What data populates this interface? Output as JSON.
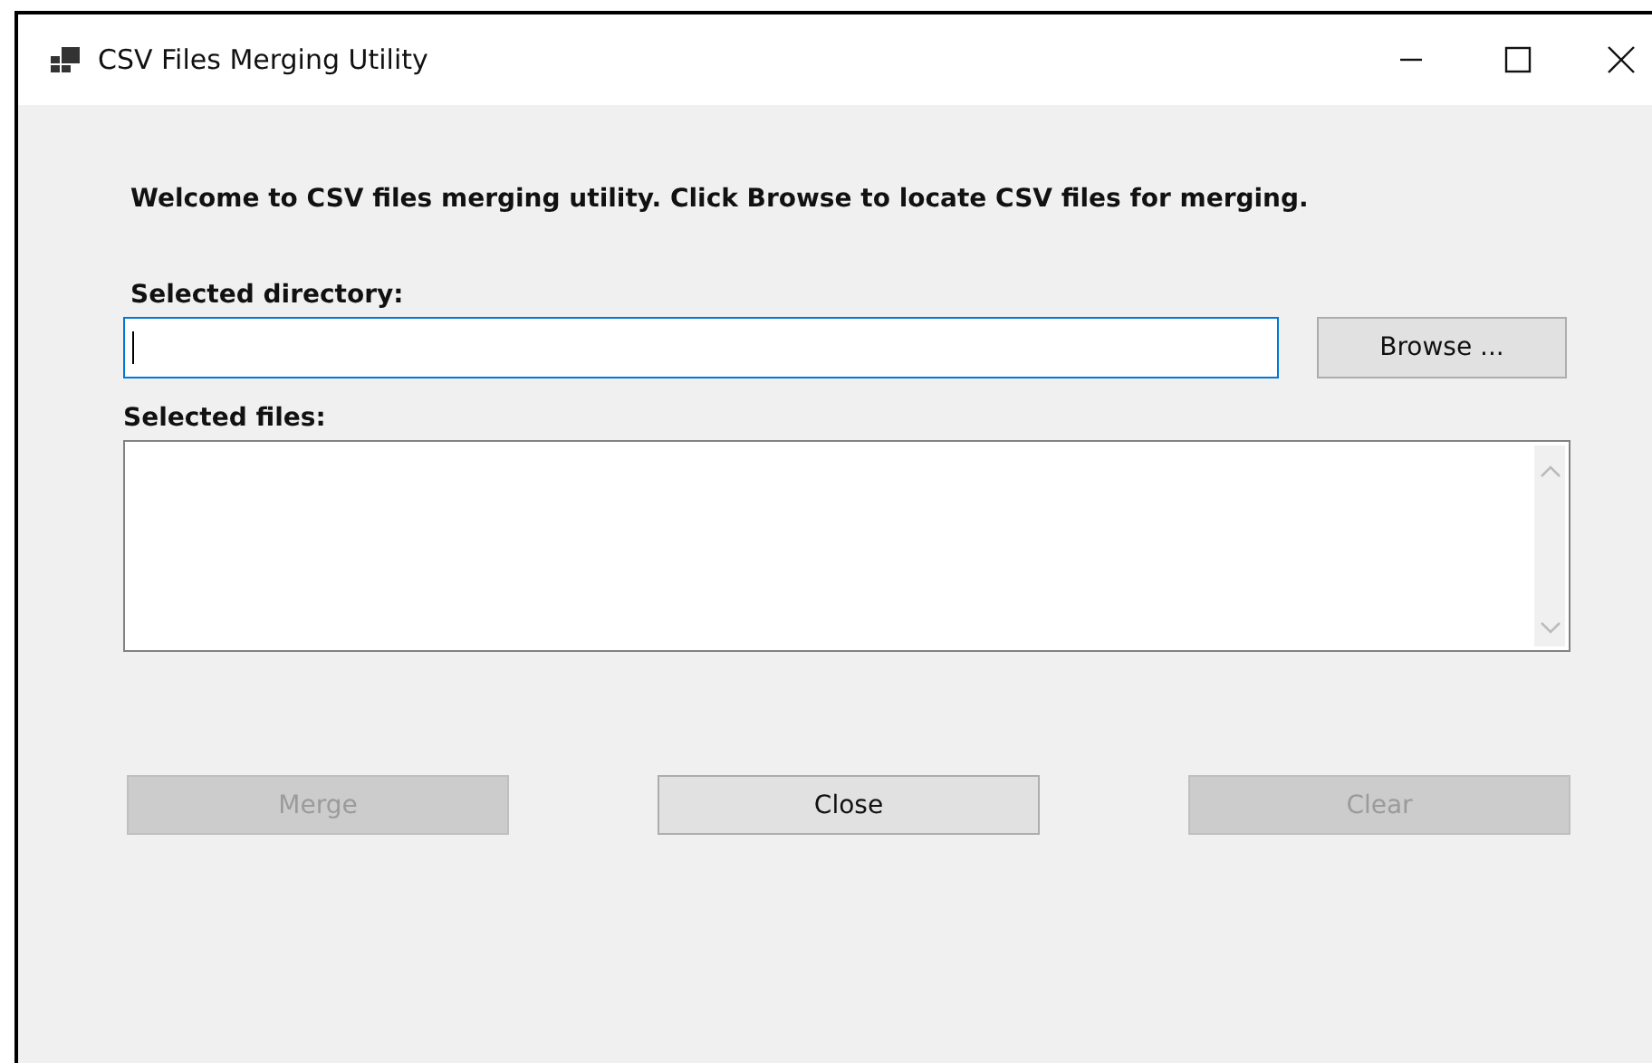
{
  "window": {
    "title": "CSV Files Merging Utility"
  },
  "welcome": "Welcome to CSV files merging utility. Click Browse to locate CSV files for merging.",
  "directory": {
    "label": "Selected directory:",
    "focused": true
  },
  "browse_button": {
    "label": "Browse ...",
    "disabled": false
  },
  "files": {
    "label": "Selected files:"
  },
  "buttons": [
    {
      "label": "Merge",
      "disabled": true
    },
    {
      "label": "Close",
      "disabled": false
    },
    {
      "label": "Clear",
      "disabled": true
    }
  ]
}
